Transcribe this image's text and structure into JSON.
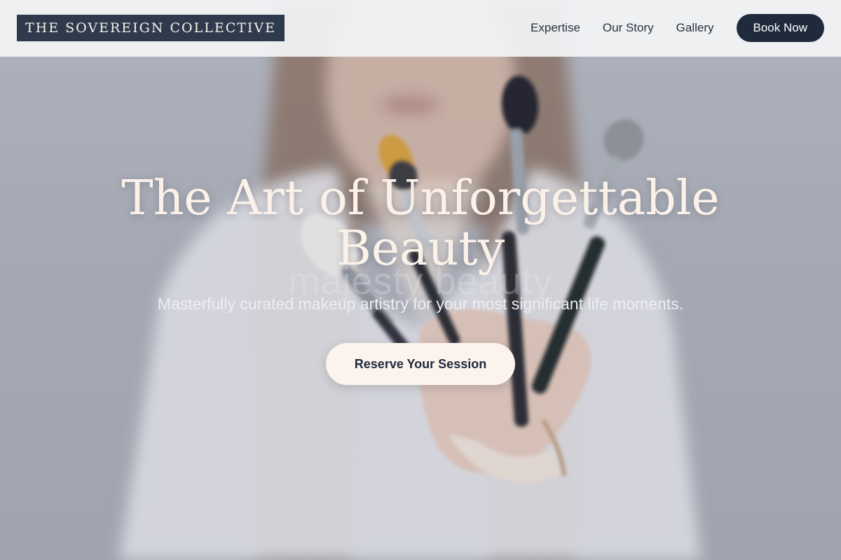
{
  "header": {
    "brand": "THE SOVEREIGN COLLECTIVE",
    "nav": [
      {
        "label": "Expertise"
      },
      {
        "label": "Our Story"
      },
      {
        "label": "Gallery"
      }
    ],
    "cta_label": "Book Now"
  },
  "hero": {
    "title": "The Art of Unforgettable Beauty",
    "ghost_text": "majesty beauty",
    "subtitle": "Masterfully curated makeup artistry for your most significant life moments.",
    "cta_label": "Reserve Your Session",
    "background_image": "woman-holding-makeup-brushes"
  },
  "colors": {
    "header_bg": "#f3f4f6",
    "brand_bg": "#2f3a4d",
    "nav_text": "#2b3240",
    "book_button_bg": "#1f2a3c",
    "hero_title": "#fbf1e8",
    "cta_bg": "#fcf3ec",
    "cta_text": "#1f2a3c"
  }
}
